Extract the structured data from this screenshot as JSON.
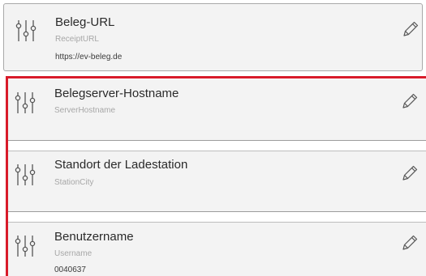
{
  "settings": [
    {
      "title": "Beleg-URL",
      "key": "ReceiptURL",
      "value": "https://ev-beleg.de"
    },
    {
      "title": "Belegserver-Hostname",
      "key": "ServerHostname",
      "value": ""
    },
    {
      "title": "Standort der Ladestation",
      "key": "StationCity",
      "value": ""
    },
    {
      "title": "Benutzername",
      "key": "Username",
      "value": "0040637"
    }
  ],
  "icons": {
    "setting": "sliders-icon",
    "edit": "pencil-icon"
  },
  "colors": {
    "highlight": "#d81b2a",
    "card_bg": "#f3f3f3",
    "border": "#a9a9a9"
  }
}
